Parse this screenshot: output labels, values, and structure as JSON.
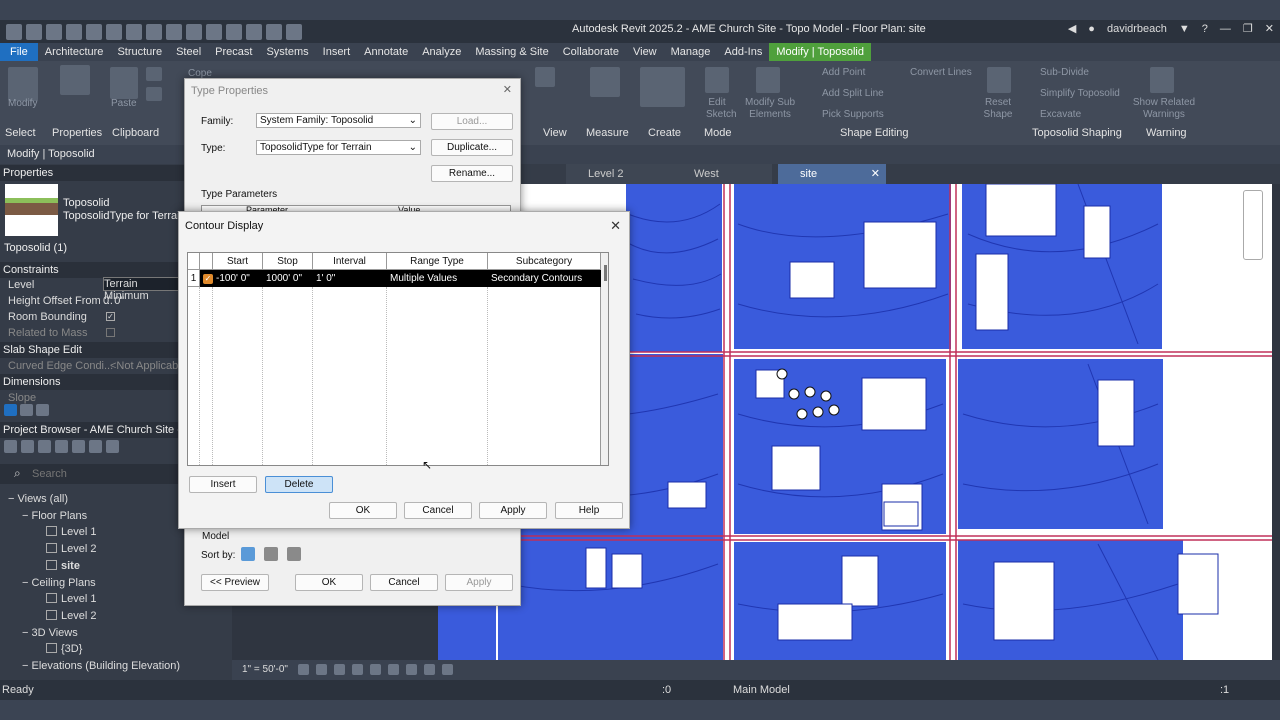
{
  "app": {
    "title": "Autodesk Revit 2025.2 - AME Church Site - Topo Model - Floor Plan: site",
    "user": "davidrbeach"
  },
  "menu": {
    "items": [
      "File",
      "Architecture",
      "Structure",
      "Steel",
      "Precast",
      "Systems",
      "Insert",
      "Annotate",
      "Analyze",
      "Massing & Site",
      "Collaborate",
      "View",
      "Manage",
      "Add-Ins",
      "Modify | Toposolid"
    ]
  },
  "ribbon": {
    "modify": "Modify",
    "paste": "Paste",
    "cope": "Cope",
    "groups": [
      "Select",
      "Properties",
      "Clipboard",
      "View",
      "Measure",
      "Create",
      "Mode",
      "Shape Editing",
      "Toposolid Shaping",
      "Warning"
    ],
    "mode_buttons": [
      "Edit Sketch",
      "Modify Sub Elements",
      "Reset Shape"
    ],
    "shape_edit": [
      "Add Point",
      "Add Split Line",
      "Pick Supports",
      "Convert Lines",
      "Sub-Divide",
      "Simplify Toposolid",
      "Excavate",
      "Show Related Warnings"
    ]
  },
  "modify_bar": "Modify | Toposolid",
  "properties": {
    "header": "Properties",
    "family": "Toposolid",
    "type": "ToposolidType for Terrain",
    "selector": "Toposolid (1)",
    "constraints": "Constraints",
    "level_key": "Level",
    "level_val": "Terrain Minimum",
    "height_key": "Height Offset From ...",
    "height_val": "0'  0\"",
    "room_key": "Room Bounding",
    "related_key": "Related to Mass",
    "slab_header": "Slab Shape Edit",
    "curved_key": "Curved Edge Condi...",
    "curved_val": "<Not Applicab",
    "dims_header": "Dimensions",
    "slope_key": "Slope"
  },
  "browser": {
    "header": "Project Browser - AME Church Site - Topo",
    "search_placeholder": "Search",
    "items": [
      "Views (all)",
      "Floor Plans",
      "Level 1",
      "Level 2",
      "site",
      "Ceiling Plans",
      "Level 1",
      "Level 2",
      "3D Views",
      "{3D}",
      "Elevations (Building Elevation)"
    ]
  },
  "view_tabs": [
    "Level 2",
    "West",
    "site"
  ],
  "view_bar": {
    "scale": "1\" = 50'-0\""
  },
  "status": {
    "left": "Ready",
    "coord": ":0",
    "model": "Main Model",
    "filter": ":1"
  },
  "type_properties": {
    "title": "Type Properties",
    "family_label": "Family:",
    "family_value": "System Family: Toposolid",
    "type_label": "Type:",
    "type_value": "ToposolidType for Terrain",
    "load": "Load...",
    "duplicate": "Duplicate...",
    "rename": "Rename...",
    "type_params": "Type Parameters",
    "col_param": "Parameter",
    "col_value": "Value",
    "model_row": "Model",
    "sort_by": "Sort by:",
    "preview": "<< Preview",
    "ok": "OK",
    "cancel": "Cancel",
    "apply": "Apply"
  },
  "contour_display": {
    "title": "Contour Display",
    "columns": [
      "Start",
      "Stop",
      "Interval",
      "Range Type",
      "Subcategory"
    ],
    "rows": [
      {
        "num": "1",
        "start": "-100'  0\"",
        "stop": "1000'  0\"",
        "interval": "1'  0\"",
        "range_type": "Multiple Values",
        "subcategory": "Secondary Contours"
      }
    ],
    "insert": "Insert",
    "delete": "Delete",
    "ok": "OK",
    "cancel": "Cancel",
    "apply": "Apply",
    "help": "Help"
  },
  "colors": {
    "accent": "#1f6fc1",
    "context_tab": "#4fa03c",
    "site_fill": "#3a5bdc",
    "road_edge": "#c0305a",
    "selection": "#000000"
  }
}
